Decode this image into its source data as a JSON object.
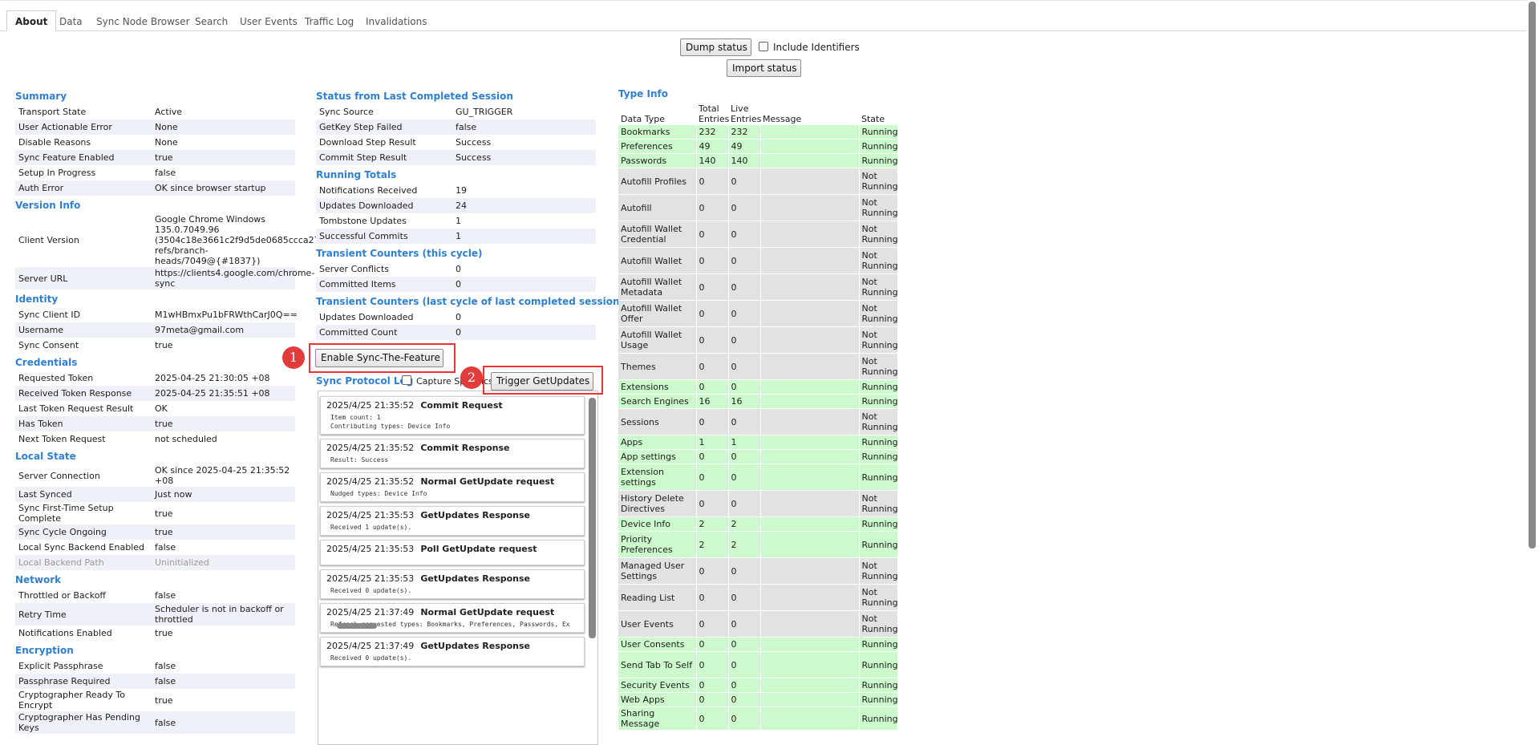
{
  "tabs": [
    {
      "label": "About",
      "active": true
    },
    {
      "label": "Data"
    },
    {
      "label": "Sync Node Browser"
    },
    {
      "label": "Search"
    },
    {
      "label": "User Events"
    },
    {
      "label": "Traffic Log"
    },
    {
      "label": "Invalidations"
    }
  ],
  "toolbar": {
    "dump_label": "Dump status",
    "include_ids_label": "Include Identifiers",
    "import_label": "Import status"
  },
  "left": {
    "summary": {
      "title": "Summary",
      "rows": [
        [
          "Transport State",
          "Active"
        ],
        [
          "User Actionable Error",
          "None"
        ],
        [
          "Disable Reasons",
          "None"
        ],
        [
          "Sync Feature Enabled",
          "true"
        ],
        [
          "Setup In Progress",
          "false"
        ],
        [
          "Auth Error",
          "OK since browser startup"
        ]
      ]
    },
    "version": {
      "title": "Version Info",
      "rows": [
        [
          "Client Version",
          "Google Chrome Windows 135.0.7049.96 (3504c18e3661c2f9d5de0685ccca27f593ad69c5-refs/branch-heads/7049@{#1837})"
        ],
        [
          "Server URL",
          "https://clients4.google.com/chrome-sync"
        ]
      ]
    },
    "identity": {
      "title": "Identity",
      "rows": [
        [
          "Sync Client ID",
          "M1wHBmxPu1bFRWthCarJ0Q=="
        ],
        [
          "Username",
          "97meta@gmail.com"
        ],
        [
          "Sync Consent",
          "true"
        ]
      ]
    },
    "credentials": {
      "title": "Credentials",
      "rows": [
        [
          "Requested Token",
          "2025-04-25 21:30:05 +08"
        ],
        [
          "Received Token Response",
          "2025-04-25 21:35:51 +08"
        ],
        [
          "Last Token Request Result",
          "OK"
        ],
        [
          "Has Token",
          "true"
        ],
        [
          "Next Token Request",
          "not scheduled"
        ]
      ]
    },
    "local": {
      "title": "Local State",
      "rows": [
        [
          "Server Connection",
          "OK since 2025-04-25 21:35:52 +08"
        ],
        [
          "Last Synced",
          "Just now"
        ],
        [
          "Sync First-Time Setup Complete",
          "true"
        ],
        [
          "Sync Cycle Ongoing",
          "true"
        ],
        [
          "Local Sync Backend Enabled",
          "false"
        ],
        [
          "Local Backend Path",
          "Uninitialized"
        ]
      ]
    },
    "network": {
      "title": "Network",
      "rows": [
        [
          "Throttled or Backoff",
          "false"
        ],
        [
          "Retry Time",
          "Scheduler is not in backoff or throttled"
        ],
        [
          "Notifications Enabled",
          "true"
        ]
      ]
    },
    "encryption": {
      "title": "Encryption",
      "rows": [
        [
          "Explicit Passphrase",
          "false"
        ],
        [
          "Passphrase Required",
          "false"
        ],
        [
          "Cryptographer Ready To Encrypt",
          "true"
        ],
        [
          "Cryptographer Has Pending Keys",
          "false"
        ]
      ]
    }
  },
  "middle": {
    "session": {
      "title": "Status from Last Completed Session",
      "rows": [
        [
          "Sync Source",
          "GU_TRIGGER"
        ],
        [
          "GetKey Step Failed",
          "false"
        ],
        [
          "Download Step Result",
          "Success"
        ],
        [
          "Commit Step Result",
          "Success"
        ]
      ]
    },
    "totals": {
      "title": "Running Totals",
      "rows": [
        [
          "Notifications Received",
          "19"
        ],
        [
          "Updates Downloaded",
          "24"
        ],
        [
          "Tombstone Updates",
          "1"
        ],
        [
          "Successful Commits",
          "1"
        ]
      ]
    },
    "transient": {
      "title": "Transient Counters (this cycle)",
      "rows": [
        [
          "Server Conflicts",
          "0"
        ],
        [
          "Committed Items",
          "0"
        ]
      ]
    },
    "transient_last": {
      "title": "Transient Counters (last cycle of last completed session)",
      "rows": [
        [
          "Updates Downloaded",
          "0"
        ],
        [
          "Committed Count",
          "0"
        ]
      ]
    },
    "enable_label": "Enable Sync-The-Feature",
    "protocol_title": "Sync Protocol Log",
    "capture_label": "Capture Specifics",
    "trigger_label": "Trigger GetUpdates",
    "log": [
      {
        "time": "2025/4/25 21:35:52",
        "title": "Commit Request",
        "detail": "Item count: 1\nContributing types: Device Info"
      },
      {
        "time": "2025/4/25 21:35:52",
        "title": "Commit Response",
        "detail": "Result: Success"
      },
      {
        "time": "2025/4/25 21:35:52",
        "title": "Normal GetUpdate request",
        "detail": "Nudged types: Device Info"
      },
      {
        "time": "2025/4/25 21:35:53",
        "title": "GetUpdates Response",
        "detail": "Received 1 update(s)."
      },
      {
        "time": "2025/4/25 21:35:53",
        "title": "Poll GetUpdate request",
        "detail": ""
      },
      {
        "time": "2025/4/25 21:35:53",
        "title": "GetUpdates Response",
        "detail": "Received 0 update(s)."
      },
      {
        "time": "2025/4/25 21:37:49",
        "title": "Normal GetUpdate request",
        "detail": "Refresh requested types: Bookmarks, Preferences, Passwords, Ex"
      },
      {
        "time": "2025/4/25 21:37:49",
        "title": "GetUpdates Response",
        "detail": "Received 0 update(s)."
      }
    ]
  },
  "typeinfo": {
    "title": "Type Info",
    "headers": [
      "Data Type",
      "Total Entries",
      "Live Entries",
      "Message",
      "State"
    ],
    "rows": [
      {
        "name": "Bookmarks",
        "total": "232",
        "live": "232",
        "message": "",
        "state": "Running"
      },
      {
        "name": "Preferences",
        "total": "49",
        "live": "49",
        "message": "",
        "state": "Running"
      },
      {
        "name": "Passwords",
        "total": "140",
        "live": "140",
        "message": "",
        "state": "Running"
      },
      {
        "name": "Autofill Profiles",
        "total": "0",
        "live": "0",
        "message": "",
        "state": "Not Running"
      },
      {
        "name": "Autofill",
        "total": "0",
        "live": "0",
        "message": "",
        "state": "Not Running"
      },
      {
        "name": "Autofill Wallet Credential",
        "total": "0",
        "live": "0",
        "message": "",
        "state": "Not Running"
      },
      {
        "name": "Autofill Wallet",
        "total": "0",
        "live": "0",
        "message": "",
        "state": "Not Running"
      },
      {
        "name": "Autofill Wallet Metadata",
        "total": "0",
        "live": "0",
        "message": "",
        "state": "Not Running"
      },
      {
        "name": "Autofill Wallet Offer",
        "total": "0",
        "live": "0",
        "message": "",
        "state": "Not Running"
      },
      {
        "name": "Autofill Wallet Usage",
        "total": "0",
        "live": "0",
        "message": "",
        "state": "Not Running"
      },
      {
        "name": "Themes",
        "total": "0",
        "live": "0",
        "message": "",
        "state": "Not Running"
      },
      {
        "name": "Extensions",
        "total": "0",
        "live": "0",
        "message": "",
        "state": "Running"
      },
      {
        "name": "Search Engines",
        "total": "16",
        "live": "16",
        "message": "",
        "state": "Running"
      },
      {
        "name": "Sessions",
        "total": "0",
        "live": "0",
        "message": "",
        "state": "Not Running"
      },
      {
        "name": "Apps",
        "total": "1",
        "live": "1",
        "message": "",
        "state": "Running"
      },
      {
        "name": "App settings",
        "total": "0",
        "live": "0",
        "message": "",
        "state": "Running"
      },
      {
        "name": "Extension settings",
        "total": "0",
        "live": "0",
        "message": "",
        "state": "Running"
      },
      {
        "name": "History Delete Directives",
        "total": "0",
        "live": "0",
        "message": "",
        "state": "Not Running"
      },
      {
        "name": "Device Info",
        "total": "2",
        "live": "2",
        "message": "",
        "state": "Running"
      },
      {
        "name": "Priority Preferences",
        "total": "2",
        "live": "2",
        "message": "",
        "state": "Running"
      },
      {
        "name": "Managed User Settings",
        "total": "0",
        "live": "0",
        "message": "",
        "state": "Not Running"
      },
      {
        "name": "Reading List",
        "total": "0",
        "live": "0",
        "message": "",
        "state": "Not Running"
      },
      {
        "name": "User Events",
        "total": "0",
        "live": "0",
        "message": "",
        "state": "Not Running"
      },
      {
        "name": "User Consents",
        "total": "0",
        "live": "0",
        "message": "",
        "state": "Running"
      },
      {
        "name": "Send Tab To Self",
        "total": "0",
        "live": "0",
        "message": "",
        "state": "Running"
      },
      {
        "name": "Security Events",
        "total": "0",
        "live": "0",
        "message": "",
        "state": "Running"
      },
      {
        "name": "Web Apps",
        "total": "0",
        "live": "0",
        "message": "",
        "state": "Running"
      },
      {
        "name": "Sharing Message",
        "total": "0",
        "live": "0",
        "message": "",
        "state": "Running"
      }
    ]
  },
  "annotations": {
    "badge1": "1",
    "badge2": "2",
    "annotation_color": "#e33b3b"
  },
  "colors": {
    "accent": "#2f80d1",
    "running": "#cdfacd",
    "not_running": "#e2e2e2"
  }
}
